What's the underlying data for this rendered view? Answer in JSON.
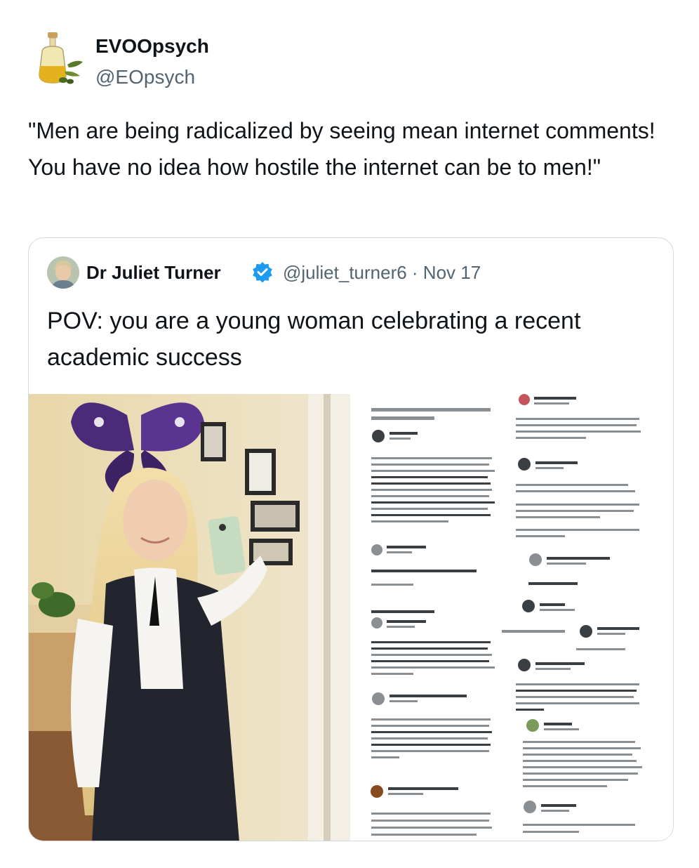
{
  "tweet": {
    "author_name": "EVOOpsych",
    "author_handle": "@EOpsych",
    "avatar_icon": "olive-oil-bottle-icon",
    "text": "\"Men are being radicalized by seeing mean internet comments! You have no idea how hostile the internet can be to men!\""
  },
  "quote": {
    "author_name": "Dr Juliet Turner",
    "verified_icon": "verified-badge-icon",
    "meta": "@juliet_turner6 · Nov 17",
    "text": "POV: you are a young woman celebrating a recent academic success",
    "media": {
      "photo_icon": "mirror-selfie-photo",
      "screenshots_icon": "blurred-comment-screenshots"
    }
  },
  "colors": {
    "text_primary": "#0f1419",
    "text_secondary": "#536471",
    "border": "#cfd9de",
    "verified": "#1d9bf0"
  }
}
